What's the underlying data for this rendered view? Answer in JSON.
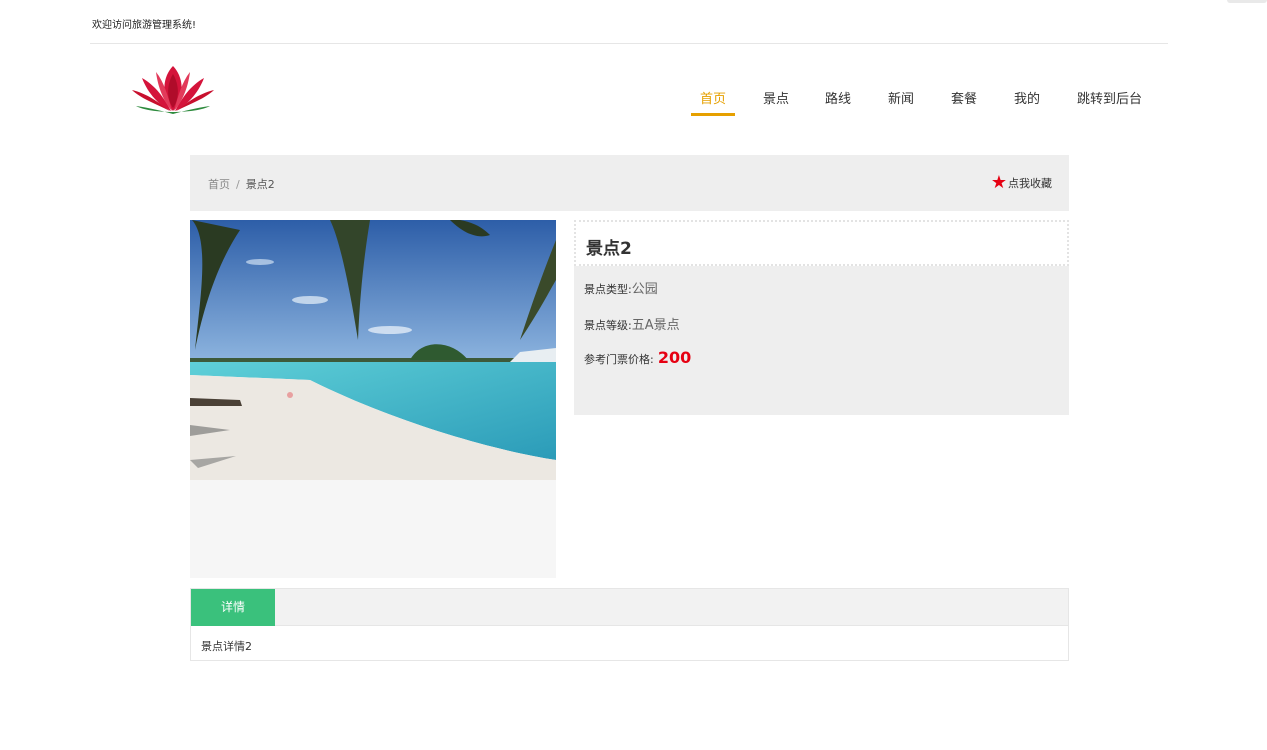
{
  "topbar": {
    "welcome": "欢迎访问旅游管理系统!"
  },
  "logo": {
    "name": "lotus-logo-icon",
    "colors": [
      "#d4143b",
      "#f08aa3",
      "#2e8b3e"
    ]
  },
  "nav": {
    "items": [
      {
        "label": "首页",
        "active": true
      },
      {
        "label": "景点",
        "active": false
      },
      {
        "label": "路线",
        "active": false
      },
      {
        "label": "新闻",
        "active": false
      },
      {
        "label": "套餐",
        "active": false
      },
      {
        "label": "我的",
        "active": false
      },
      {
        "label": "跳转到后台",
        "active": false
      }
    ],
    "active_color": "#e6a000"
  },
  "breadcrumb": {
    "home": "首页",
    "separator": "/",
    "current": "景点2"
  },
  "favorite": {
    "icon": "star-icon",
    "label": "点我收藏",
    "color": "#e60012"
  },
  "attraction": {
    "title": "景点2",
    "type_label": "景点类型:",
    "type_value": "公园",
    "level_label": "景点等级:",
    "level_value": "五A景点",
    "price_label": "参考门票价格:",
    "price_value": "200"
  },
  "detail": {
    "tab_label": "详情",
    "content": "景点详情2",
    "tab_color": "#3ac17c"
  }
}
